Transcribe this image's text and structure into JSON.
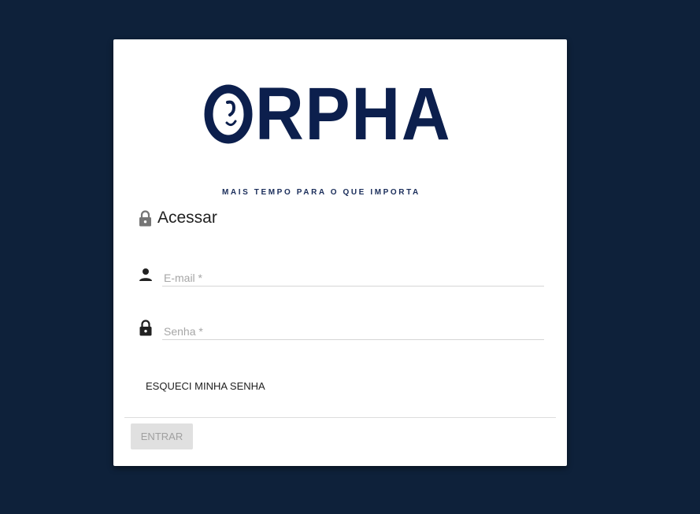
{
  "brand": {
    "name": "ORPHA",
    "name_rest": "RPHA",
    "tagline": "MAIS TEMPO PARA O QUE IMPORTA",
    "color": "#0c1f4d"
  },
  "login": {
    "heading": "Acessar",
    "heading_icon": "lock-icon",
    "email": {
      "placeholder": "E-mail *",
      "value": "",
      "icon": "person-icon"
    },
    "password": {
      "placeholder": "Senha *",
      "value": "",
      "icon": "lock-icon"
    },
    "forgot_label": "ESQUECI MINHA SENHA",
    "submit_label": "ENTRAR",
    "submit_disabled": true
  },
  "colors": {
    "background": "#0e213a",
    "card": "#ffffff",
    "button_disabled_bg": "#e0e0e0",
    "button_disabled_text": "#a0a0a0"
  }
}
